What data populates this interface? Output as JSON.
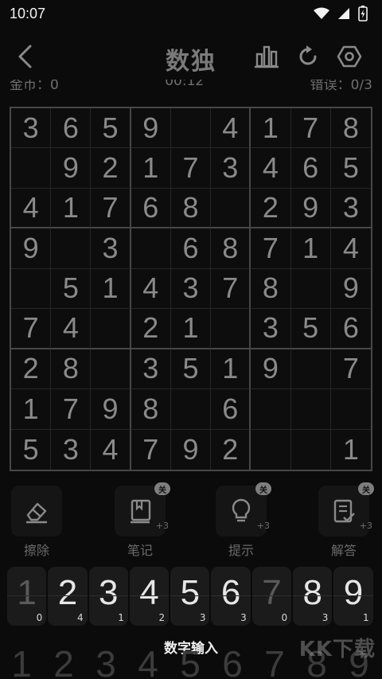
{
  "status": {
    "time": "10:07"
  },
  "header": {
    "title": "数独"
  },
  "info": {
    "coins": "金币：0",
    "timer": "00:12",
    "errors": "错误：0/3"
  },
  "board": [
    [
      "3",
      "6",
      "5",
      "9",
      "",
      "4",
      "1",
      "7",
      "8"
    ],
    [
      "",
      "9",
      "2",
      "1",
      "7",
      "3",
      "4",
      "6",
      "5"
    ],
    [
      "4",
      "1",
      "7",
      "6",
      "8",
      "",
      "2",
      "9",
      "3"
    ],
    [
      "9",
      "",
      "3",
      "",
      "6",
      "8",
      "7",
      "1",
      "4"
    ],
    [
      "",
      "5",
      "1",
      "4",
      "3",
      "7",
      "8",
      "",
      "9"
    ],
    [
      "7",
      "4",
      "",
      "2",
      "1",
      "",
      "3",
      "5",
      "6"
    ],
    [
      "2",
      "8",
      "",
      "3",
      "5",
      "1",
      "9",
      "",
      "7"
    ],
    [
      "1",
      "7",
      "9",
      "8",
      "",
      "6",
      "",
      "",
      ""
    ],
    [
      "5",
      "3",
      "4",
      "7",
      "9",
      "2",
      "",
      "",
      "1"
    ]
  ],
  "tools": [
    {
      "label": "擦除",
      "icon": "eraser-icon"
    },
    {
      "label": "笔记",
      "icon": "notebook-icon",
      "badge": "关",
      "plus": "+3"
    },
    {
      "label": "提示",
      "icon": "lightbulb-icon",
      "badge": "关",
      "plus": "+3"
    },
    {
      "label": "解答",
      "icon": "clipboard-check-icon",
      "badge": "关",
      "plus": "+3"
    }
  ],
  "numpad": [
    {
      "digit": "1",
      "count": "0"
    },
    {
      "digit": "2",
      "count": "4"
    },
    {
      "digit": "3",
      "count": "1"
    },
    {
      "digit": "4",
      "count": "2"
    },
    {
      "digit": "5",
      "count": "3"
    },
    {
      "digit": "6",
      "count": "3"
    },
    {
      "digit": "7",
      "count": "0"
    },
    {
      "digit": "8",
      "count": "3"
    },
    {
      "digit": "9",
      "count": "1"
    }
  ],
  "mode_label": "数字输入",
  "bottom_digits": [
    "1",
    "2",
    "3",
    "4",
    "5",
    "6",
    "7",
    "8",
    "9"
  ],
  "watermark": "KK下载"
}
